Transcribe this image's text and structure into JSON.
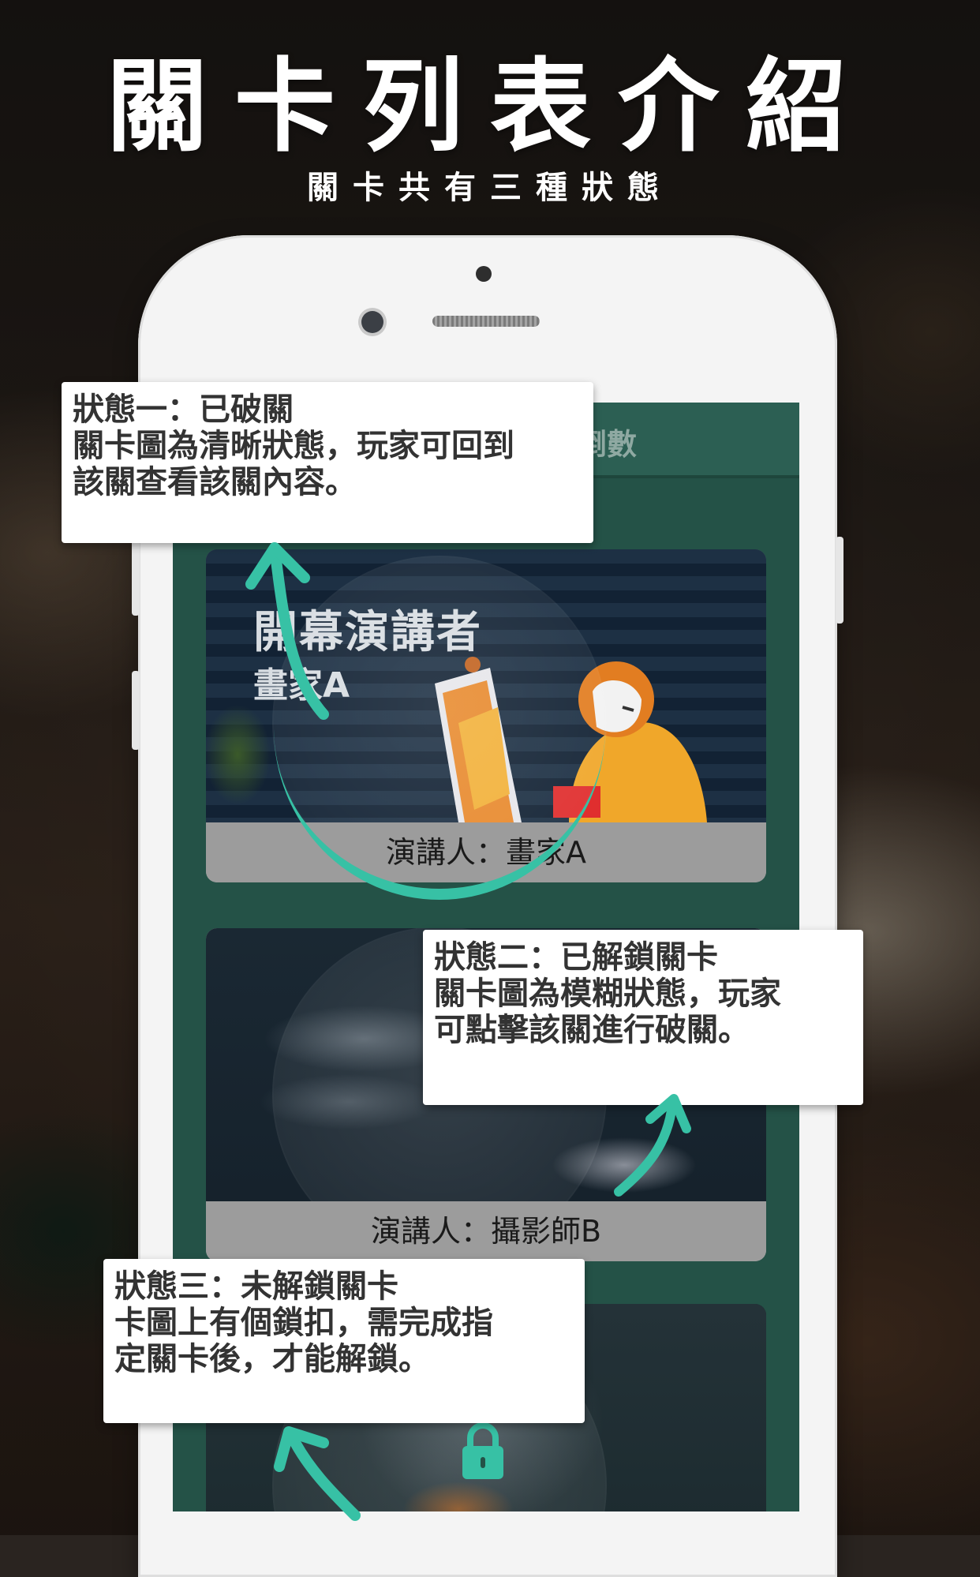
{
  "title": "關卡列表介紹",
  "subtitle": "關卡共有三種狀態",
  "screen": {
    "header_text": "倒數"
  },
  "cards": [
    {
      "title": "開幕演講者",
      "subtitle": "畫家A",
      "caption": "演講人：畫家A"
    },
    {
      "caption": "演講人：攝影師B"
    },
    {
      "locked": true
    }
  ],
  "callouts": [
    {
      "lines": [
        "狀態一：已破關",
        "關卡圖為清晰狀態，玩家可回到",
        "該關查看該關內容。"
      ]
    },
    {
      "lines": [
        "狀態二：已解鎖關卡",
        "關卡圖為模糊狀態，玩家",
        "可點擊該關進行破關。"
      ]
    },
    {
      "lines": [
        "狀態三：未解鎖關卡",
        "卡圖上有個鎖扣，需完成指",
        "定關卡後，才能解鎖。"
      ]
    }
  ],
  "icons": {
    "lock": "lock-icon",
    "arrow": "curved-arrow-icon"
  },
  "colors": {
    "accent": "#37c1a5",
    "screen_bg": "#245247",
    "header_bg": "#2c5f53"
  }
}
